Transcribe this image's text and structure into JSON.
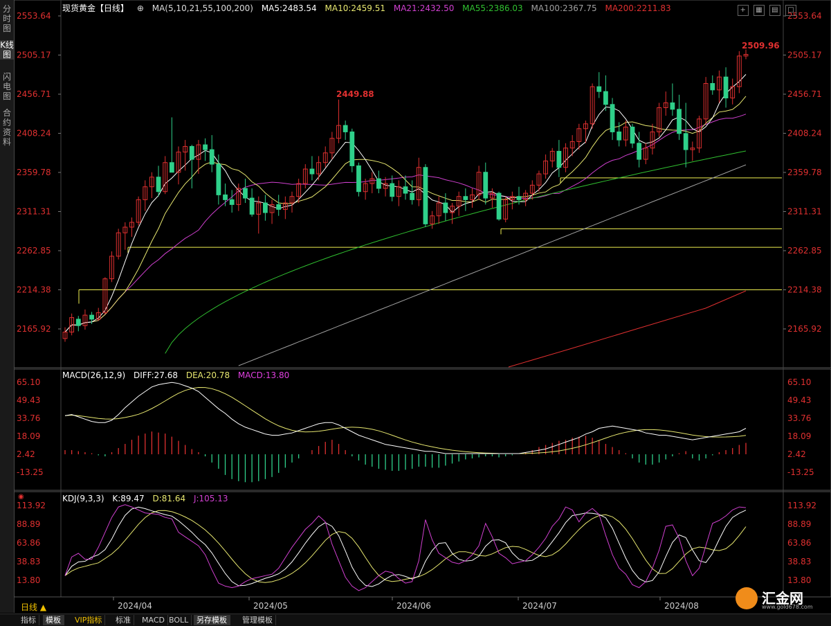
{
  "left_tabs": [
    "分时图",
    "K线图",
    "闪电图",
    "合约资料"
  ],
  "main_info": {
    "symbol": "现货黄金【日线】",
    "ma_params": "MA(5,10,21,55,100,200)",
    "ma5": "MA5:2483.54",
    "ma10": "MA10:2459.51",
    "ma21": "MA21:2432.50",
    "ma55": "MA55:2386.03",
    "ma100": "MA100:2367.75",
    "ma200": "MA200:2211.83"
  },
  "macd_info": {
    "label": "MACD(26,12,9)",
    "diff": "DIFF:27.68",
    "dea": "DEA:20.78",
    "macd": "MACD:13.80"
  },
  "kdj_info": {
    "label": "KDJ(9,3,3)",
    "k": "K:89.47",
    "d": "D:81.64",
    "j": "J:105.13"
  },
  "price_axis": [
    "2553.64",
    "2505.17",
    "2456.71",
    "2408.24",
    "2359.78",
    "2311.31",
    "2262.85",
    "2214.38",
    "2165.92"
  ],
  "macd_axis": [
    "65.10",
    "49.43",
    "33.76",
    "18.09",
    "2.42",
    "-13.25"
  ],
  "kdj_axis": [
    "113.92",
    "88.89",
    "63.86",
    "38.83",
    "13.80"
  ],
  "date_axis": [
    "2024/04",
    "2024/05",
    "2024/06",
    "2024/07",
    "2024/08"
  ],
  "annotations": {
    "high_label": "2449.88",
    "last_high_label": "2509.96"
  },
  "bottom_tabs": [
    "指标",
    "模板",
    "VIP指标",
    "标准",
    "MACD",
    "BOLL",
    "另存模板",
    "管理模板"
  ],
  "period_label": "日线 ▲",
  "logo": {
    "text": "汇金网",
    "url": "www.gold678.com"
  },
  "colors": {
    "up": "#e03030",
    "down": "#2fd08a",
    "ma5": "#ffffff",
    "ma10": "#e8e870",
    "ma21": "#d040d0",
    "ma55": "#30c030",
    "ma100": "#a0a0a0",
    "ma200": "#e03030",
    "support": "#f0f050",
    "diff": "#ffffff",
    "dea": "#e8e870",
    "macdtext": "#e040e0",
    "k": "#ffffff",
    "d": "#e8e870",
    "j": "#d040d0"
  },
  "chart_data": {
    "type": "candlestick",
    "series": [
      {
        "name": "现货黄金",
        "ohlc": [
          [
            2154,
            2168,
            2150,
            2162
          ],
          [
            2162,
            2185,
            2158,
            2180
          ],
          [
            2178,
            2182,
            2163,
            2170
          ],
          [
            2170,
            2190,
            2165,
            2183
          ],
          [
            2183,
            2187,
            2172,
            2178
          ],
          [
            2178,
            2192,
            2176,
            2186
          ],
          [
            2186,
            2230,
            2184,
            2228
          ],
          [
            2228,
            2262,
            2224,
            2256
          ],
          [
            2256,
            2290,
            2252,
            2285
          ],
          [
            2285,
            2298,
            2264,
            2292
          ],
          [
            2292,
            2304,
            2280,
            2298
          ],
          [
            2298,
            2330,
            2294,
            2326
          ],
          [
            2326,
            2350,
            2312,
            2342
          ],
          [
            2342,
            2360,
            2328,
            2354
          ],
          [
            2354,
            2368,
            2330,
            2336
          ],
          [
            2336,
            2380,
            2333,
            2372
          ],
          [
            2372,
            2428,
            2365,
            2360
          ],
          [
            2360,
            2392,
            2345,
            2385
          ],
          [
            2385,
            2400,
            2362,
            2392
          ],
          [
            2392,
            2394,
            2340,
            2376
          ],
          [
            2376,
            2400,
            2358,
            2394
          ],
          [
            2394,
            2402,
            2374,
            2388
          ],
          [
            2388,
            2406,
            2360,
            2370
          ],
          [
            2370,
            2382,
            2320,
            2332
          ],
          [
            2332,
            2346,
            2318,
            2326
          ],
          [
            2326,
            2338,
            2310,
            2320
          ],
          [
            2320,
            2346,
            2312,
            2340
          ],
          [
            2340,
            2352,
            2322,
            2328
          ],
          [
            2328,
            2340,
            2305,
            2308
          ],
          [
            2308,
            2330,
            2284,
            2322
          ],
          [
            2322,
            2332,
            2300,
            2310
          ],
          [
            2310,
            2326,
            2296,
            2320
          ],
          [
            2320,
            2332,
            2306,
            2314
          ],
          [
            2314,
            2330,
            2302,
            2322
          ],
          [
            2322,
            2336,
            2310,
            2330
          ],
          [
            2330,
            2352,
            2322,
            2346
          ],
          [
            2346,
            2370,
            2340,
            2364
          ],
          [
            2364,
            2380,
            2350,
            2358
          ],
          [
            2358,
            2380,
            2350,
            2372
          ],
          [
            2372,
            2392,
            2366,
            2384
          ],
          [
            2384,
            2410,
            2376,
            2402
          ],
          [
            2402,
            2450,
            2396,
            2418
          ],
          [
            2418,
            2424,
            2400,
            2410
          ],
          [
            2410,
            2414,
            2360,
            2368
          ],
          [
            2368,
            2372,
            2330,
            2336
          ],
          [
            2336,
            2352,
            2326,
            2346
          ],
          [
            2346,
            2360,
            2334,
            2352
          ],
          [
            2352,
            2362,
            2334,
            2340
          ],
          [
            2340,
            2354,
            2330,
            2346
          ],
          [
            2346,
            2356,
            2324,
            2330
          ],
          [
            2330,
            2350,
            2318,
            2342
          ],
          [
            2342,
            2356,
            2326,
            2334
          ],
          [
            2334,
            2350,
            2320,
            2326
          ],
          [
            2326,
            2378,
            2318,
            2366
          ],
          [
            2366,
            2370,
            2292,
            2296
          ],
          [
            2296,
            2312,
            2290,
            2306
          ],
          [
            2306,
            2330,
            2296,
            2322
          ],
          [
            2322,
            2334,
            2300,
            2310
          ],
          [
            2310,
            2322,
            2296,
            2318
          ],
          [
            2318,
            2336,
            2306,
            2330
          ],
          [
            2330,
            2340,
            2312,
            2326
          ],
          [
            2326,
            2340,
            2316,
            2332
          ],
          [
            2332,
            2368,
            2326,
            2360
          ],
          [
            2360,
            2372,
            2320,
            2328
          ],
          [
            2328,
            2340,
            2316,
            2334
          ],
          [
            2334,
            2336,
            2300,
            2302
          ],
          [
            2302,
            2330,
            2298,
            2326
          ],
          [
            2326,
            2336,
            2314,
            2330
          ],
          [
            2330,
            2342,
            2320,
            2326
          ],
          [
            2326,
            2338,
            2318,
            2334
          ],
          [
            2334,
            2350,
            2326,
            2344
          ],
          [
            2344,
            2362,
            2336,
            2358
          ],
          [
            2358,
            2382,
            2352,
            2374
          ],
          [
            2374,
            2390,
            2366,
            2386
          ],
          [
            2386,
            2400,
            2354,
            2366
          ],
          [
            2366,
            2396,
            2360,
            2390
          ],
          [
            2390,
            2406,
            2380,
            2398
          ],
          [
            2398,
            2420,
            2388,
            2414
          ],
          [
            2414,
            2424,
            2396,
            2420
          ],
          [
            2420,
            2470,
            2414,
            2466
          ],
          [
            2466,
            2484,
            2452,
            2460
          ],
          [
            2460,
            2480,
            2436,
            2444
          ],
          [
            2444,
            2452,
            2400,
            2410
          ],
          [
            2410,
            2422,
            2392,
            2400
          ],
          [
            2400,
            2424,
            2392,
            2416
          ],
          [
            2416,
            2420,
            2390,
            2396
          ],
          [
            2396,
            2410,
            2366,
            2376
          ],
          [
            2376,
            2396,
            2370,
            2390
          ],
          [
            2390,
            2420,
            2382,
            2410
          ],
          [
            2410,
            2446,
            2404,
            2440
          ],
          [
            2440,
            2460,
            2430,
            2446
          ],
          [
            2446,
            2470,
            2430,
            2438
          ],
          [
            2438,
            2456,
            2400,
            2408
          ],
          [
            2408,
            2446,
            2366,
            2388
          ],
          [
            2388,
            2398,
            2374,
            2390
          ],
          [
            2390,
            2430,
            2384,
            2426
          ],
          [
            2426,
            2478,
            2420,
            2470
          ],
          [
            2470,
            2480,
            2456,
            2462
          ],
          [
            2462,
            2486,
            2446,
            2478
          ],
          [
            2478,
            2490,
            2440,
            2452
          ],
          [
            2452,
            2476,
            2444,
            2466
          ],
          [
            2466,
            2510,
            2458,
            2504
          ],
          [
            2504,
            2512,
            2500,
            2506
          ]
        ]
      }
    ],
    "support_levels": [
      2214.38,
      2267,
      2290,
      2353
    ],
    "y_range": [
      2140,
      2560
    ],
    "macd_range": [
      -27,
      72
    ],
    "kdj_range": [
      -5,
      125
    ]
  }
}
